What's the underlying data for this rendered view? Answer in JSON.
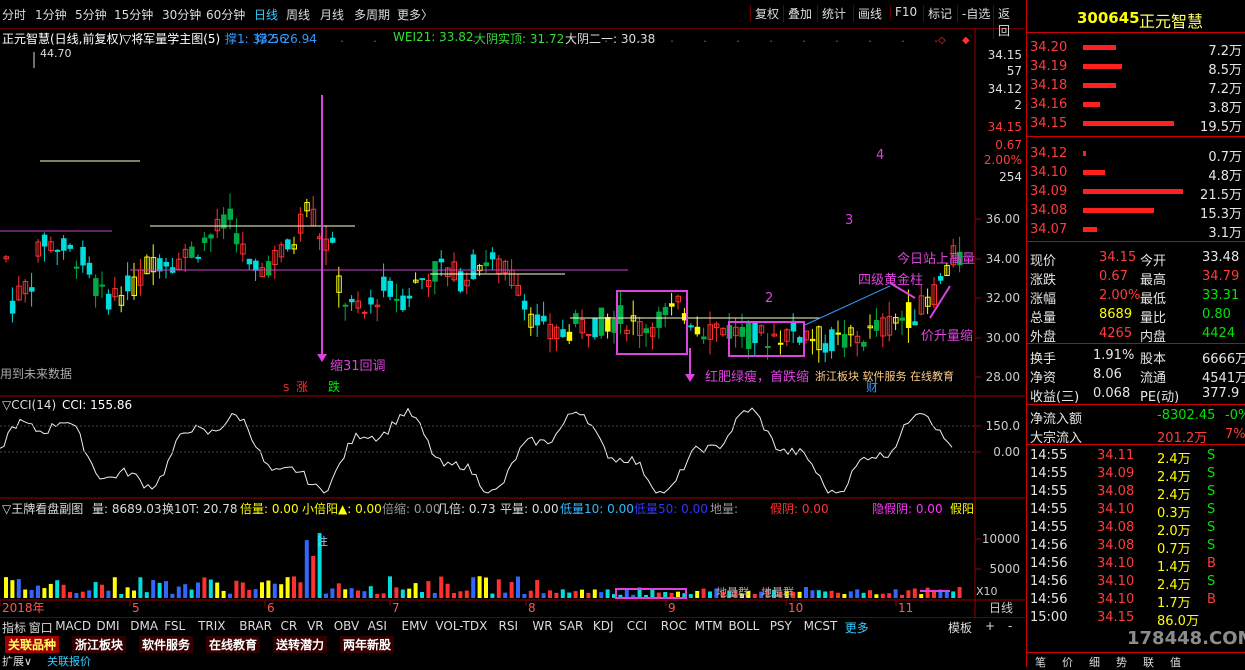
{
  "toolbar": {
    "periods": [
      "分时",
      "1分钟",
      "5分钟",
      "15分钟",
      "30分钟",
      "60分钟",
      "日线",
      "周线",
      "月线",
      "多周期",
      "更多〉"
    ],
    "active_period": "日线",
    "right_buttons": [
      "复权",
      "叠加",
      "统计",
      "画线",
      "F10",
      "标记",
      "-自选",
      "返回"
    ]
  },
  "main_chart": {
    "title": "正元智慧(日线,前复权)",
    "indicator_name": "▽将军量学主图(5)",
    "legend": [
      {
        "label": "撑1: 33.56",
        "color": "#3399ff"
      },
      {
        "label": "撑2: 26.94",
        "color": "#3399ff"
      },
      {
        "label": "WEI21: 33.82",
        "color": "#33dd33"
      },
      {
        "label": "大阴实顶: 31.72",
        "color": "#33dd33"
      },
      {
        "label": "大阴二一: 30.38",
        "color": "#dddddd"
      }
    ],
    "high_label": "44.70",
    "y_ticks": [
      "36.00",
      "34.00",
      "32.00",
      "30.00",
      "28.00"
    ],
    "right_labels": [
      "34.15",
      "57",
      "34.12",
      "2",
      "34.15",
      "0.67",
      "2.00%",
      "254"
    ],
    "annotations": {
      "future_data": "用到未来数据",
      "pullback": "缩31回调",
      "red_fat_green_thin": "红肥绿瘦，首跌缩",
      "service": "浙江板块 软件服务 在线教育",
      "num2": "2",
      "num3": "3",
      "num4": "4",
      "four_gold": "四级黄金柱",
      "today_high": "今日站上高量",
      "rise_price": "价升量缩",
      "zhang": "涨",
      "die": "跌",
      "s_mark": "S",
      "cai": "财"
    }
  },
  "cci": {
    "title": "▽CCI(14)",
    "value": "CCI: 155.86",
    "y_ticks": [
      "150.0",
      "0.00"
    ]
  },
  "volume": {
    "title": "▽王牌看盘副图",
    "legend": [
      {
        "label": "量: 8689.03",
        "color": "#dddddd"
      },
      {
        "label": "换10T: 20.78",
        "color": "#dddddd"
      },
      {
        "label": "倍量: 0.00",
        "color": "#ffff00"
      },
      {
        "label": "小倍阳▲: 0.00",
        "color": "#ffff00"
      },
      {
        "label": "倍缩: 0.00",
        "color": "#999999"
      },
      {
        "label": "几倍: 0.73",
        "color": "#dddddd"
      },
      {
        "label": "平量: 0.00",
        "color": "#dddddd"
      },
      {
        "label": "低量10: 0.00",
        "color": "#33bbff"
      },
      {
        "label": "低量50: 0.00",
        "color": "#3333ff"
      },
      {
        "label": "地量:",
        "color": "#999999"
      },
      {
        "label": "假阴: 0.00",
        "color": "#ff3333"
      },
      {
        "label": "隐假阴: 0.00",
        "color": "#ff33ff"
      },
      {
        "label": "假阳",
        "color": "#ffff00"
      }
    ],
    "y_ticks": [
      "10000",
      "5000"
    ],
    "x10": "X10",
    "note": "注",
    "tags": [
      "地量群",
      "地量群"
    ]
  },
  "xaxis": {
    "labels": [
      "2018年",
      "5",
      "6",
      "7",
      "8",
      "9",
      "10",
      "11"
    ],
    "unit": "日线"
  },
  "tabs_row1": [
    "指标",
    "窗口",
    "MACD",
    "DMI",
    "DMA",
    "FSL",
    "TRIX",
    "BRAR",
    "CR",
    "VR",
    "OBV",
    "ASI",
    "EMV",
    "VOL-TDX",
    "RSI",
    "WR",
    "SAR",
    "KDJ",
    "CCI",
    "ROC",
    "MTM",
    "BOLL",
    "PSY",
    "MCST",
    "更多"
  ],
  "tabs_row1_right": [
    "模板",
    "+",
    "-"
  ],
  "tabs_row2": [
    "关联品种",
    "浙江板块",
    "软件服务",
    "在线教育",
    "送转潜力",
    "两年新股"
  ],
  "tabs_row3": [
    "扩展∨",
    "关联报价"
  ],
  "stock": {
    "code": "300645",
    "name": "正元智慧",
    "asks": [
      {
        "price": "34.20",
        "vol": "7.2万",
        "bar": 0.33
      },
      {
        "price": "34.19",
        "vol": "8.5万",
        "bar": 0.39
      },
      {
        "price": "34.18",
        "vol": "7.2万",
        "bar": 0.33
      },
      {
        "price": "34.16",
        "vol": "3.8万",
        "bar": 0.17
      },
      {
        "price": "34.15",
        "vol": "19.5万",
        "bar": 0.91
      }
    ],
    "bids": [
      {
        "price": "34.12",
        "vol": "0.7万",
        "bar": 0.03
      },
      {
        "price": "34.10",
        "vol": "4.8万",
        "bar": 0.22
      },
      {
        "price": "34.09",
        "vol": "21.5万",
        "bar": 1.0
      },
      {
        "price": "34.08",
        "vol": "15.3万",
        "bar": 0.71
      },
      {
        "price": "34.07",
        "vol": "3.1万",
        "bar": 0.14
      }
    ],
    "quote": [
      {
        "l": "现价",
        "v": "34.15",
        "vc": "red",
        "l2": "今开",
        "v2": "33.48",
        "v2c": "white"
      },
      {
        "l": "涨跌",
        "v": "0.67",
        "vc": "red",
        "l2": "最高",
        "v2": "34.79",
        "v2c": "red"
      },
      {
        "l": "涨幅",
        "v": "2.00%",
        "vc": "red",
        "l2": "最低",
        "v2": "33.31",
        "v2c": "green"
      },
      {
        "l": "总量",
        "v": "8689",
        "vc": "yellow",
        "l2": "量比",
        "v2": "0.80",
        "v2c": "green"
      },
      {
        "l": "外盘",
        "v": "4265",
        "vc": "red",
        "l2": "内盘",
        "v2": "4424",
        "v2c": "green"
      }
    ],
    "stats": [
      {
        "l": "换手",
        "v": "1.91%",
        "l2": "股本",
        "v2": "6666万"
      },
      {
        "l": "净资",
        "v": "8.06",
        "l2": "流通",
        "v2": "4541万"
      },
      {
        "l": "收益(三)",
        "v": "0.068",
        "l2": "PE(动)",
        "v2": "377.9"
      }
    ],
    "flow": [
      {
        "l": "净流入额",
        "v": "-8302.45",
        "vc": "green",
        "v2": "-0%",
        "v2c": "green"
      },
      {
        "l": "大宗流入",
        "v": "201.2万",
        "vc": "red",
        "v2": "7%",
        "v2c": "red"
      }
    ],
    "ticks": [
      {
        "t": "14:55",
        "p": "34.11",
        "v": "2.4万",
        "s": "S",
        "sc": "green"
      },
      {
        "t": "14:55",
        "p": "34.09",
        "v": "2.4万",
        "s": "S",
        "sc": "green"
      },
      {
        "t": "14:55",
        "p": "34.08",
        "v": "2.4万",
        "s": "S",
        "sc": "green"
      },
      {
        "t": "14:55",
        "p": "34.10",
        "v": "0.3万",
        "s": "S",
        "sc": "green"
      },
      {
        "t": "14:55",
        "p": "34.08",
        "v": "2.0万",
        "s": "S",
        "sc": "green"
      },
      {
        "t": "14:56",
        "p": "34.08",
        "v": "0.7万",
        "s": "S",
        "sc": "green"
      },
      {
        "t": "14:56",
        "p": "34.10",
        "v": "1.4万",
        "s": "B",
        "sc": "red"
      },
      {
        "t": "14:56",
        "p": "34.10",
        "v": "2.4万",
        "s": "S",
        "sc": "green"
      },
      {
        "t": "14:56",
        "p": "34.10",
        "v": "1.7万",
        "s": "B",
        "sc": "red"
      },
      {
        "t": "15:00",
        "p": "34.15",
        "v": "86.0万",
        "s": "",
        "sc": "red"
      }
    ],
    "bottom_tabs": [
      "笔",
      "价",
      "细",
      "势",
      "联",
      "值"
    ],
    "watermark": "178448.COM"
  }
}
